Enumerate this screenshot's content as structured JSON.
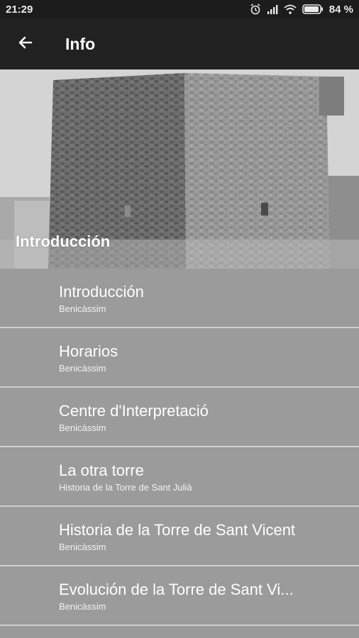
{
  "status_bar": {
    "time": "21:29",
    "battery_percent": "84 %",
    "icons": [
      "alarm-icon",
      "signal-icon",
      "wifi-icon",
      "battery-icon"
    ]
  },
  "app_bar": {
    "title": "Info",
    "back_icon": "arrow-left-icon"
  },
  "hero": {
    "caption": "Introducción"
  },
  "list": {
    "items": [
      {
        "title": "Introducción",
        "subtitle": "Benicàssim"
      },
      {
        "title": "Horarios",
        "subtitle": "Benicàssim"
      },
      {
        "title": "Centre d'Interpretació",
        "subtitle": "Benicàssim"
      },
      {
        "title": "La otra torre",
        "subtitle": "Historia de la Torre de Sant Julià"
      },
      {
        "title": "Historia de la Torre de Sant Vicent",
        "subtitle": "Benicàssim"
      },
      {
        "title": "Evolución de la Torre de Sant Vi...",
        "subtitle": "Benicàssim"
      }
    ]
  }
}
